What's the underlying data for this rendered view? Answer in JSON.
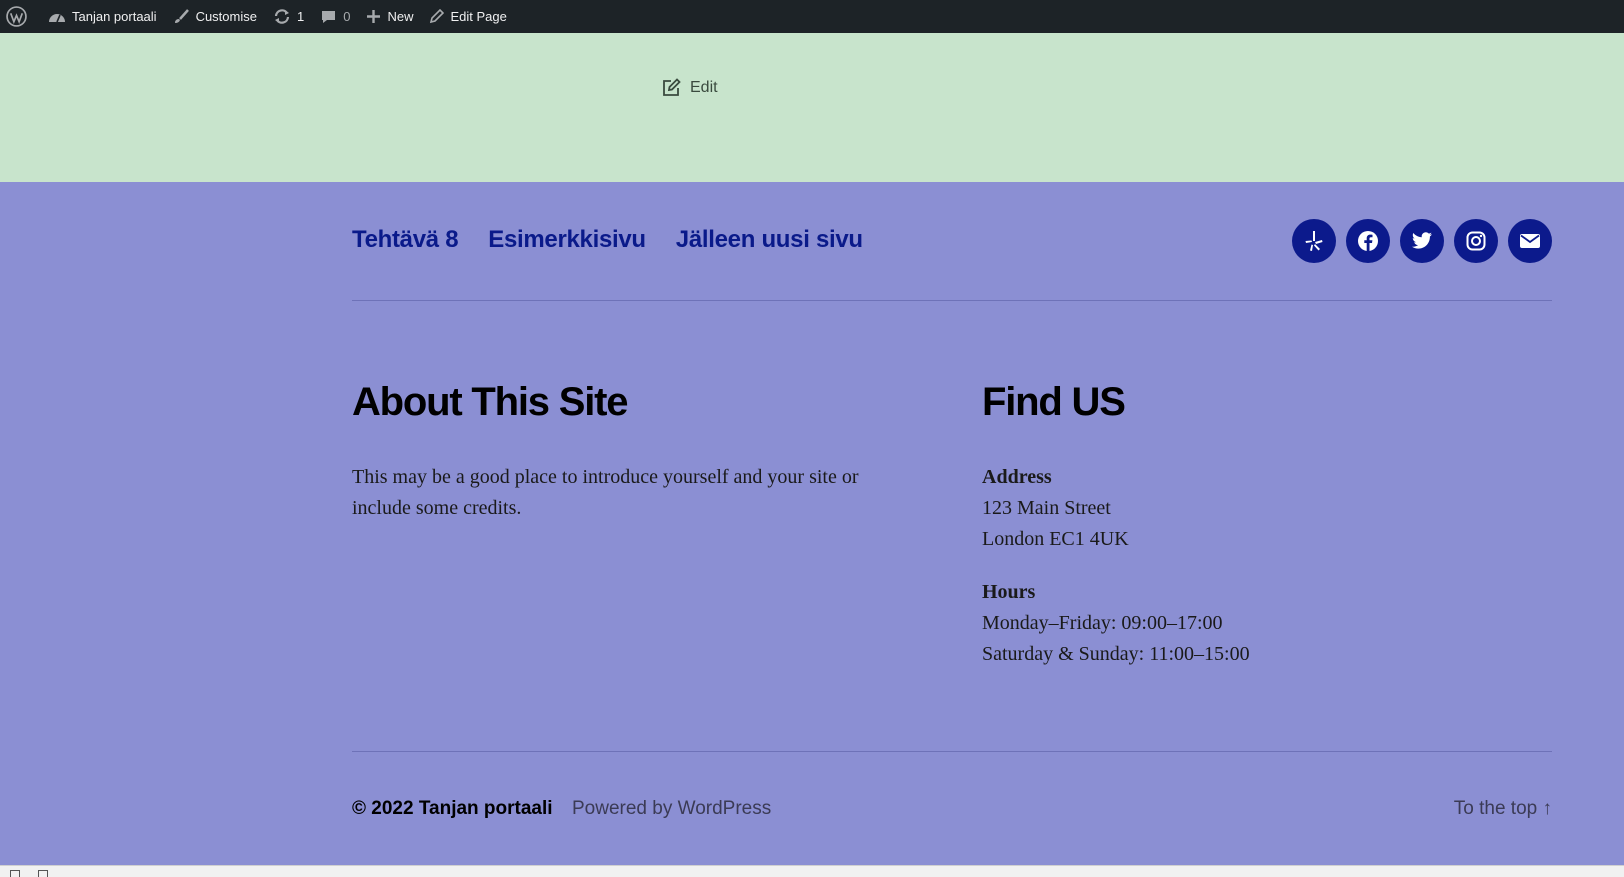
{
  "admin_bar": {
    "site_name": "Tanjan portaali",
    "customise": "Customise",
    "updates_count": "1",
    "comments_count": "0",
    "new_label": "New",
    "edit_page": "Edit Page"
  },
  "edit_link": "Edit",
  "footer_nav": [
    "Tehtävä 8",
    "Esimerkkisivu",
    "Jälleen uusi sivu"
  ],
  "socials": [
    "yelp-icon",
    "facebook-icon",
    "twitter-icon",
    "instagram-icon",
    "mail-icon"
  ],
  "about": {
    "title": "About This Site",
    "text": "This may be a good place to introduce yourself and your site or include some credits."
  },
  "find": {
    "title": "Find US",
    "address_label": "Address",
    "address_line1": "123 Main Street",
    "address_line2": "London EC1 4UK",
    "hours_label": "Hours",
    "hours_line1": "Monday–Friday: 09:00–17:00",
    "hours_line2": "Saturday & Sunday: 11:00–15:00"
  },
  "bottom": {
    "copyright": "© 2022 Tanjan portaali",
    "powered": "Powered by WordPress",
    "to_top": "To the top ↑"
  }
}
